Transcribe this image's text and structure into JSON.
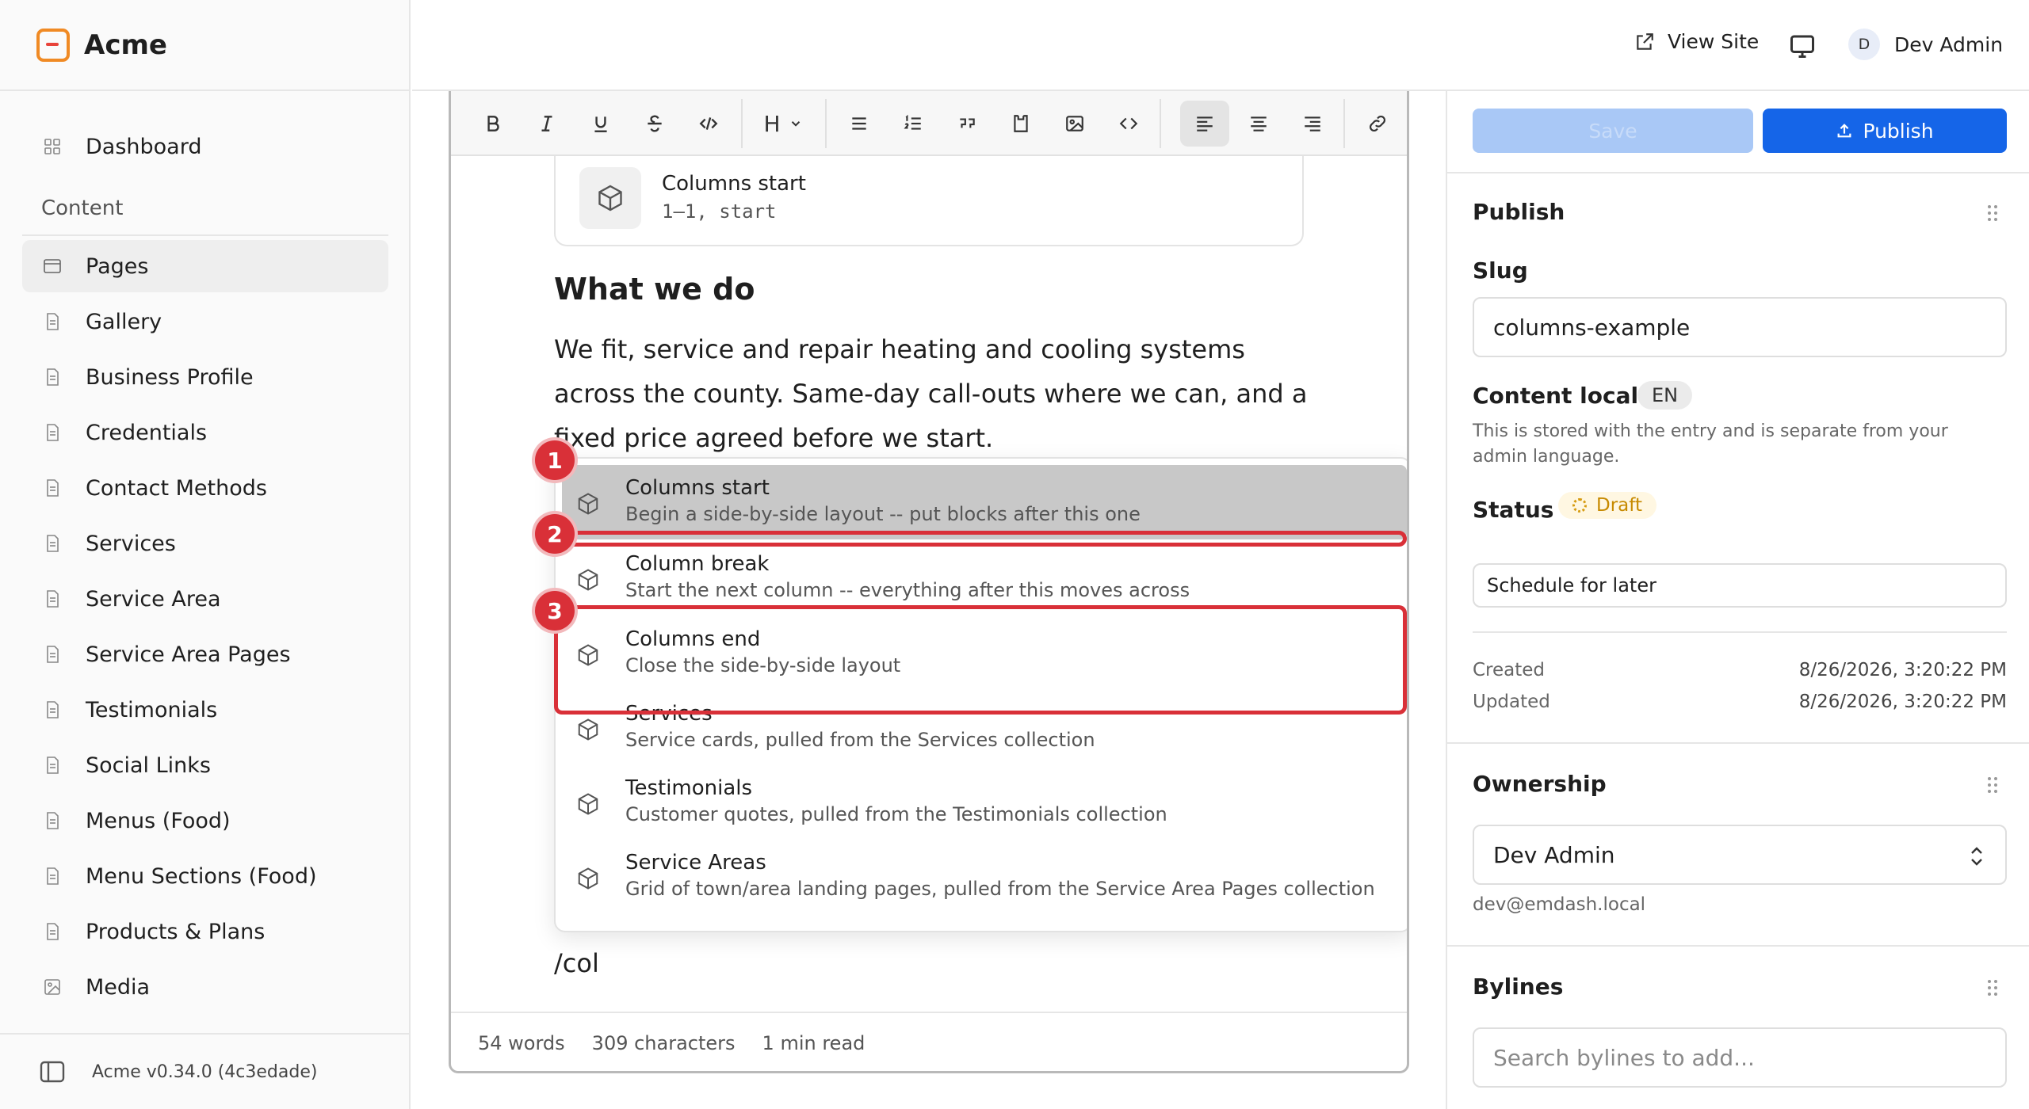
{
  "brand": {
    "name": "Acme"
  },
  "sidebar": {
    "section": "Content",
    "items": [
      {
        "label": "Dashboard",
        "icon": "grid-icon"
      },
      {
        "label": "Pages",
        "icon": "page-layout-icon",
        "active": true
      },
      {
        "label": "Gallery",
        "icon": "document-icon"
      },
      {
        "label": "Business Profile",
        "icon": "document-icon"
      },
      {
        "label": "Credentials",
        "icon": "document-icon"
      },
      {
        "label": "Contact Methods",
        "icon": "document-icon"
      },
      {
        "label": "Services",
        "icon": "document-icon"
      },
      {
        "label": "Service Area",
        "icon": "document-icon"
      },
      {
        "label": "Service Area Pages",
        "icon": "document-icon"
      },
      {
        "label": "Testimonials",
        "icon": "document-icon"
      },
      {
        "label": "Social Links",
        "icon": "document-icon"
      },
      {
        "label": "Menus (Food)",
        "icon": "document-icon"
      },
      {
        "label": "Menu Sections (Food)",
        "icon": "document-icon"
      },
      {
        "label": "Products & Plans",
        "icon": "document-icon"
      },
      {
        "label": "Media",
        "icon": "image-icon"
      }
    ],
    "version": "Acme v0.34.0 (4c3edade)"
  },
  "topbar": {
    "view_site": "View Site",
    "user_initial": "D",
    "user_name": "Dev Admin"
  },
  "toolbar": {
    "buttons": [
      "bold",
      "italic",
      "underline",
      "strikethrough",
      "inline-code",
      "heading",
      "bullet-list",
      "ordered-list",
      "blockquote",
      "block-insert",
      "image",
      "code-block",
      "align-left",
      "align-center",
      "align-right",
      "link"
    ],
    "heading_label": "H"
  },
  "editor": {
    "block_card": {
      "title": "Columns start",
      "subtitle": "1–1, start"
    },
    "heading": "What we do",
    "paragraph": "We fit, service and repair heating and cooling systems across the county. Same-day call-outs where we can, and a fixed price agreed before we start.",
    "slash_text": "/col",
    "menu": [
      {
        "title": "Columns start",
        "desc": "Begin a side-by-side layout -- put blocks after this one",
        "selected": true
      },
      {
        "title": "Column break",
        "desc": "Start the next column -- everything after this moves across"
      },
      {
        "title": "Columns end",
        "desc": "Close the side-by-side layout"
      },
      {
        "title": "Services",
        "desc": "Service cards, pulled from the Services collection"
      },
      {
        "title": "Testimonials",
        "desc": "Customer quotes, pulled from the Testimonials collection"
      },
      {
        "title": "Service Areas",
        "desc": "Grid of town/area landing pages, pulled from the Service Area Pages collection"
      }
    ],
    "annotations": [
      "1",
      "2",
      "3"
    ],
    "footer": {
      "words": "54 words",
      "chars": "309 characters",
      "read": "1 min read"
    }
  },
  "panel": {
    "save_label": "Save",
    "publish_label": "Publish",
    "publish_section": "Publish",
    "slug_label": "Slug",
    "slug_value": "columns-example",
    "locale_label": "Content locale",
    "locale_value": "EN",
    "locale_help": "This is stored with the entry and is separate from your admin language.",
    "status_label": "Status",
    "status_value": "Draft",
    "schedule_label": "Schedule for later",
    "created_label": "Created",
    "created_value": "8/26/2026, 3:20:22 PM",
    "updated_label": "Updated",
    "updated_value": "8/26/2026, 3:20:22 PM",
    "ownership_section": "Ownership",
    "owner_value": "Dev Admin",
    "owner_email": "dev@emdash.local",
    "bylines_section": "Bylines",
    "bylines_placeholder": "Search bylines to add..."
  },
  "colors": {
    "accent": "#1565e8",
    "annotation": "#d93038",
    "draft": "#c78a00"
  }
}
